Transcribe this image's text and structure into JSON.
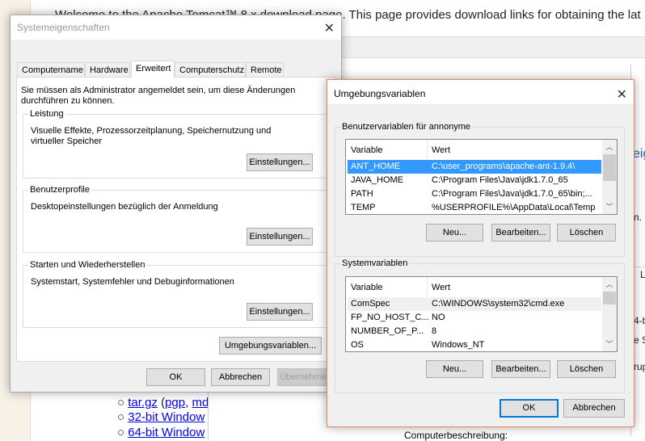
{
  "background": {
    "intro": "Welcome to the Apache Tomcat™ 8.x download page. This page provides download links for obtaining the lat",
    "fragments": [
      "eig",
      "n.",
      "L",
      "4-b",
      "e S",
      "rup"
    ],
    "list": [
      {
        "link": "tar.gz",
        "rest": " (",
        "link2": "pgp",
        ",": ", ",
        "link3": "md"
      },
      {
        "link": "32-bit Window"
      },
      {
        "link": "64-bit Window"
      }
    ],
    "computer_description": "Computerbeschreibung:"
  },
  "sysprops": {
    "title": "Systemeigenschaften",
    "tabs": [
      "Computername",
      "Hardware",
      "Erweitert",
      "Computerschutz",
      "Remote"
    ],
    "selected_tab": "Erweitert",
    "admin_note": "Sie müssen als Administrator angemeldet sein, um diese Änderungen durchführen zu können.",
    "groups": [
      {
        "label": "Leistung",
        "text": "Visuelle Effekte, Prozessorzeitplanung, Speichernutzung und virtueller Speicher",
        "button": "Einstellungen..."
      },
      {
        "label": "Benutzerprofile",
        "text": "Desktopeinstellungen bezüglich der Anmeldung",
        "button": "Einstellungen..."
      },
      {
        "label": "Starten und Wiederherstellen",
        "text": "Systemstart, Systemfehler und Debuginformationen",
        "button": "Einstellungen..."
      }
    ],
    "env_button": "Umgebungsvariablen...",
    "ok": "OK",
    "cancel": "Abbrechen",
    "apply": "Übernehmen"
  },
  "envvars": {
    "title": "Umgebungsvariablen",
    "user": {
      "label": "Benutzervariablen für annonyme",
      "col_variable": "Variable",
      "col_value": "Wert",
      "rows": [
        [
          "ANT_HOME",
          "C:\\user_programs\\apache-ant-1.9.4\\"
        ],
        [
          "JAVA_HOME",
          "C:\\Program Files\\Java\\jdk1.7.0_65"
        ],
        [
          "PATH",
          "C:\\Program Files\\Java\\jdk1.7.0_65\\bin;..."
        ],
        [
          "TEMP",
          "%USERPROFILE%\\AppData\\Local\\Temp"
        ]
      ],
      "selected": "ANT_HOME",
      "new": "Neu...",
      "edit": "Bearbeiten...",
      "delete": "Löschen"
    },
    "system": {
      "label": "Systemvariablen",
      "col_variable": "Variable",
      "col_value": "Wert",
      "rows": [
        [
          "ComSpec",
          "C:\\WINDOWS\\system32\\cmd.exe"
        ],
        [
          "FP_NO_HOST_C...",
          "NO"
        ],
        [
          "NUMBER_OF_P...",
          "8"
        ],
        [
          "OS",
          "Windows_NT"
        ]
      ],
      "new": "Neu...",
      "edit": "Bearbeiten...",
      "delete": "Löschen"
    },
    "ok": "OK",
    "cancel": "Abbrechen"
  },
  "colors": {
    "selection": "#3399ff",
    "accent_border": "#e8845c",
    "default_button": "#0078d7"
  }
}
